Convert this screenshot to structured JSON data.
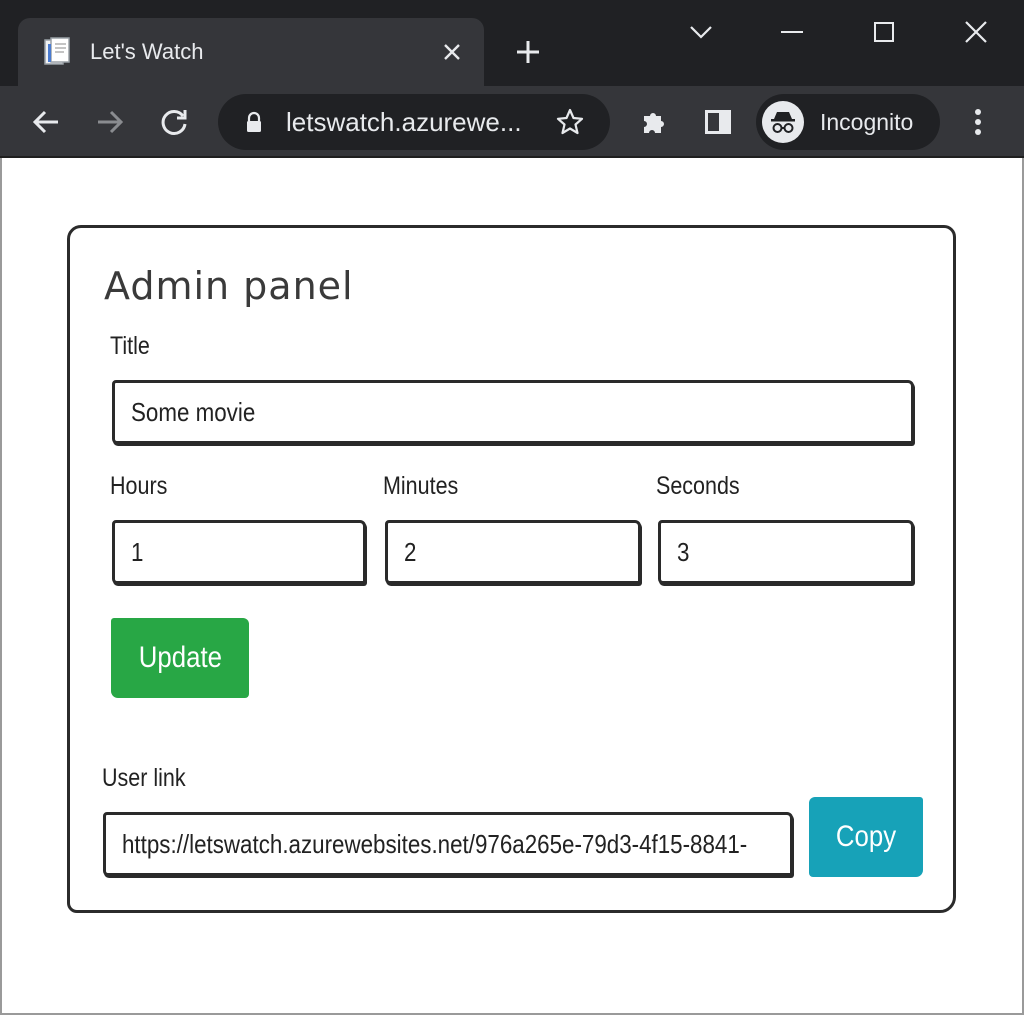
{
  "browser": {
    "tab_title": "Let's Watch",
    "url": "letswatch.azurewe...",
    "profile_label": "Incognito",
    "icons": {
      "favicon": "document-stack-icon",
      "tab_close": "close-icon",
      "new_tab": "plus-icon",
      "tab_search": "chevron-down-icon",
      "minimize": "minimize-icon",
      "maximize": "maximize-icon",
      "close": "close-icon",
      "back": "arrow-left-icon",
      "forward": "arrow-right-icon",
      "reload": "reload-icon",
      "lock": "lock-icon",
      "bookmark": "star-icon",
      "extensions": "puzzle-icon",
      "side_panel": "side-panel-icon",
      "incognito": "incognito-icon",
      "menu": "kebab-menu-icon"
    }
  },
  "admin": {
    "heading": "Admin panel",
    "title_label": "Title",
    "title_value": "Some movie",
    "hours_label": "Hours",
    "hours_value": "1",
    "minutes_label": "Minutes",
    "minutes_value": "2",
    "seconds_label": "Seconds",
    "seconds_value": "3",
    "update_label": "Update",
    "user_link_label": "User link",
    "user_link_value": "https://letswatch.azurewebsites.net/976a265e-79d3-4f15-8841-",
    "copy_label": "Copy"
  },
  "colors": {
    "update_button": "#28a745",
    "copy_button": "#17a2b8",
    "chrome_dark": "#202124",
    "chrome_toolbar": "#35363a"
  }
}
